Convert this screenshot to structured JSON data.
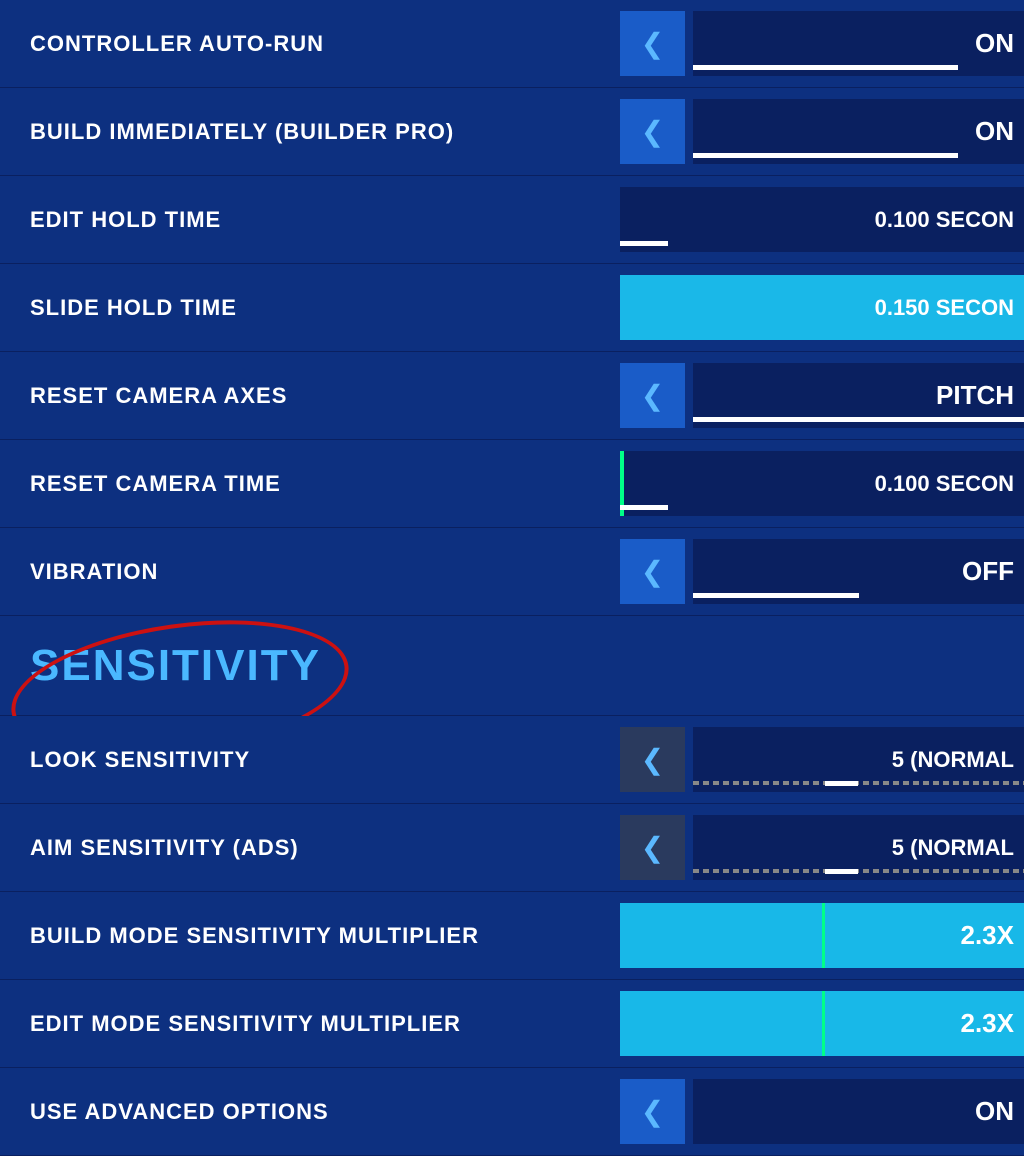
{
  "settings": {
    "rows": [
      {
        "id": "controller-auto-run",
        "label": "CONTROLLER AUTO-RUN",
        "control_type": "toggle",
        "value": "ON",
        "has_arrow": true,
        "arrow_dark": false,
        "value_box_cyan": false,
        "slider_pct": 80,
        "slider_white": true
      },
      {
        "id": "build-immediately",
        "label": "BUILD IMMEDIATELY (BUILDER PRO)",
        "control_type": "toggle",
        "value": "ON",
        "has_arrow": true,
        "arrow_dark": false,
        "value_box_cyan": false,
        "slider_pct": 80,
        "slider_white": true
      },
      {
        "id": "edit-hold-time",
        "label": "EDIT HOLD TIME",
        "control_type": "value",
        "value": "0.100 Secon",
        "has_arrow": false,
        "arrow_dark": false,
        "value_box_cyan": false,
        "slider_pct": 10,
        "slider_white": true
      },
      {
        "id": "slide-hold-time",
        "label": "SLIDE HOLD TIME",
        "control_type": "value",
        "value": "0.150 Secon",
        "has_arrow": false,
        "arrow_dark": false,
        "value_box_cyan": true,
        "slider_pct": 0,
        "slider_white": false
      },
      {
        "id": "reset-camera-axes",
        "label": "RESET CAMERA AXES",
        "control_type": "toggle",
        "value": "PITCH",
        "has_arrow": true,
        "arrow_dark": false,
        "value_box_cyan": false,
        "slider_pct": 100,
        "slider_white": true
      },
      {
        "id": "reset-camera-time",
        "label": "RESET CAMERA TIME",
        "control_type": "value",
        "value": "0.100 Secon",
        "has_arrow": false,
        "arrow_dark": false,
        "value_box_cyan": false,
        "slider_pct": 10,
        "slider_white": true,
        "has_green_left": true
      },
      {
        "id": "vibration",
        "label": "VIBRATION",
        "control_type": "toggle",
        "value": "OFF",
        "has_arrow": true,
        "arrow_dark": false,
        "value_box_cyan": false,
        "slider_pct": 50,
        "slider_white": true
      }
    ],
    "section": {
      "title": "SENSITIVITY"
    },
    "sensitivity_rows": [
      {
        "id": "look-sensitivity",
        "label": "LOOK SENSITIVITY",
        "control_type": "toggle",
        "value": "5 (NORMAL",
        "has_arrow": true,
        "arrow_dark": true,
        "value_box_cyan": false,
        "slider_dashed": true
      },
      {
        "id": "aim-sensitivity",
        "label": "AIM SENSITIVITY (ADS)",
        "control_type": "toggle",
        "value": "5 (NORMAL",
        "has_arrow": true,
        "arrow_dark": true,
        "value_box_cyan": false,
        "slider_dashed": true
      },
      {
        "id": "build-mode-multiplier",
        "label": "BUILD MODE SENSITIVITY MULTIPLIER",
        "control_type": "multiplier",
        "value": "2.3x",
        "has_arrow": false,
        "arrow_dark": false,
        "value_box_cyan": true,
        "slider_dashed": false
      },
      {
        "id": "edit-mode-multiplier",
        "label": "EDIT MODE SENSITIVITY MULTIPLIER",
        "control_type": "multiplier",
        "value": "2.3x",
        "has_arrow": false,
        "arrow_dark": false,
        "value_box_cyan": true,
        "slider_dashed": false
      },
      {
        "id": "use-advanced-options",
        "label": "USE ADVANCED OPTIONS",
        "control_type": "toggle",
        "value": "ON",
        "has_arrow": true,
        "arrow_dark": false,
        "value_box_cyan": false,
        "slider_dashed": false
      }
    ]
  },
  "icons": {
    "left_arrow": "❮"
  }
}
